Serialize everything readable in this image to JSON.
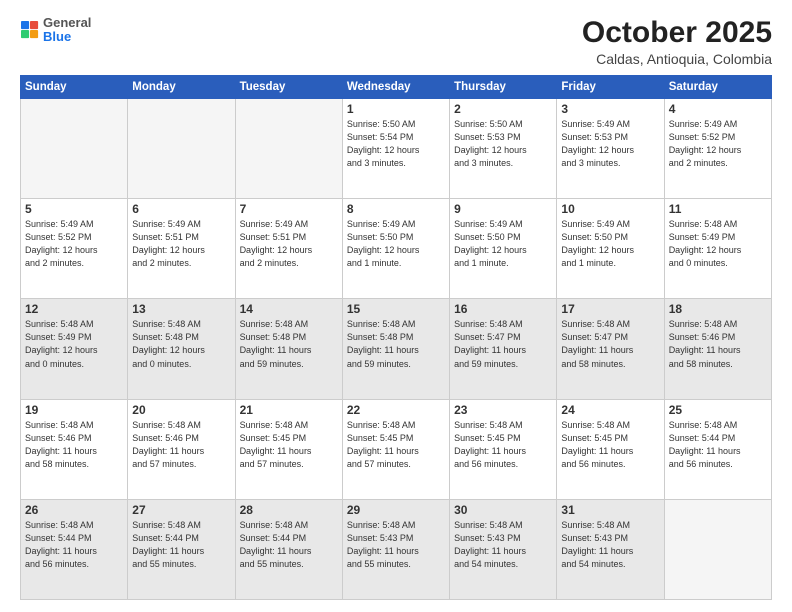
{
  "logo": {
    "general": "General",
    "blue": "Blue"
  },
  "title": "October 2025",
  "subtitle": "Caldas, Antioquia, Colombia",
  "headers": [
    "Sunday",
    "Monday",
    "Tuesday",
    "Wednesday",
    "Thursday",
    "Friday",
    "Saturday"
  ],
  "weeks": [
    [
      {
        "day": "",
        "info": "",
        "empty": true
      },
      {
        "day": "",
        "info": "",
        "empty": true
      },
      {
        "day": "",
        "info": "",
        "empty": true
      },
      {
        "day": "1",
        "info": "Sunrise: 5:50 AM\nSunset: 5:54 PM\nDaylight: 12 hours\nand 3 minutes."
      },
      {
        "day": "2",
        "info": "Sunrise: 5:50 AM\nSunset: 5:53 PM\nDaylight: 12 hours\nand 3 minutes."
      },
      {
        "day": "3",
        "info": "Sunrise: 5:49 AM\nSunset: 5:53 PM\nDaylight: 12 hours\nand 3 minutes."
      },
      {
        "day": "4",
        "info": "Sunrise: 5:49 AM\nSunset: 5:52 PM\nDaylight: 12 hours\nand 2 minutes."
      }
    ],
    [
      {
        "day": "5",
        "info": "Sunrise: 5:49 AM\nSunset: 5:52 PM\nDaylight: 12 hours\nand 2 minutes."
      },
      {
        "day": "6",
        "info": "Sunrise: 5:49 AM\nSunset: 5:51 PM\nDaylight: 12 hours\nand 2 minutes."
      },
      {
        "day": "7",
        "info": "Sunrise: 5:49 AM\nSunset: 5:51 PM\nDaylight: 12 hours\nand 2 minutes."
      },
      {
        "day": "8",
        "info": "Sunrise: 5:49 AM\nSunset: 5:50 PM\nDaylight: 12 hours\nand 1 minute."
      },
      {
        "day": "9",
        "info": "Sunrise: 5:49 AM\nSunset: 5:50 PM\nDaylight: 12 hours\nand 1 minute."
      },
      {
        "day": "10",
        "info": "Sunrise: 5:49 AM\nSunset: 5:50 PM\nDaylight: 12 hours\nand 1 minute."
      },
      {
        "day": "11",
        "info": "Sunrise: 5:48 AM\nSunset: 5:49 PM\nDaylight: 12 hours\nand 0 minutes."
      }
    ],
    [
      {
        "day": "12",
        "info": "Sunrise: 5:48 AM\nSunset: 5:49 PM\nDaylight: 12 hours\nand 0 minutes.",
        "shaded": true
      },
      {
        "day": "13",
        "info": "Sunrise: 5:48 AM\nSunset: 5:48 PM\nDaylight: 12 hours\nand 0 minutes.",
        "shaded": true
      },
      {
        "day": "14",
        "info": "Sunrise: 5:48 AM\nSunset: 5:48 PM\nDaylight: 11 hours\nand 59 minutes.",
        "shaded": true
      },
      {
        "day": "15",
        "info": "Sunrise: 5:48 AM\nSunset: 5:48 PM\nDaylight: 11 hours\nand 59 minutes.",
        "shaded": true
      },
      {
        "day": "16",
        "info": "Sunrise: 5:48 AM\nSunset: 5:47 PM\nDaylight: 11 hours\nand 59 minutes.",
        "shaded": true
      },
      {
        "day": "17",
        "info": "Sunrise: 5:48 AM\nSunset: 5:47 PM\nDaylight: 11 hours\nand 58 minutes.",
        "shaded": true
      },
      {
        "day": "18",
        "info": "Sunrise: 5:48 AM\nSunset: 5:46 PM\nDaylight: 11 hours\nand 58 minutes.",
        "shaded": true
      }
    ],
    [
      {
        "day": "19",
        "info": "Sunrise: 5:48 AM\nSunset: 5:46 PM\nDaylight: 11 hours\nand 58 minutes."
      },
      {
        "day": "20",
        "info": "Sunrise: 5:48 AM\nSunset: 5:46 PM\nDaylight: 11 hours\nand 57 minutes."
      },
      {
        "day": "21",
        "info": "Sunrise: 5:48 AM\nSunset: 5:45 PM\nDaylight: 11 hours\nand 57 minutes."
      },
      {
        "day": "22",
        "info": "Sunrise: 5:48 AM\nSunset: 5:45 PM\nDaylight: 11 hours\nand 57 minutes."
      },
      {
        "day": "23",
        "info": "Sunrise: 5:48 AM\nSunset: 5:45 PM\nDaylight: 11 hours\nand 56 minutes."
      },
      {
        "day": "24",
        "info": "Sunrise: 5:48 AM\nSunset: 5:45 PM\nDaylight: 11 hours\nand 56 minutes."
      },
      {
        "day": "25",
        "info": "Sunrise: 5:48 AM\nSunset: 5:44 PM\nDaylight: 11 hours\nand 56 minutes."
      }
    ],
    [
      {
        "day": "26",
        "info": "Sunrise: 5:48 AM\nSunset: 5:44 PM\nDaylight: 11 hours\nand 56 minutes.",
        "shaded": true
      },
      {
        "day": "27",
        "info": "Sunrise: 5:48 AM\nSunset: 5:44 PM\nDaylight: 11 hours\nand 55 minutes.",
        "shaded": true
      },
      {
        "day": "28",
        "info": "Sunrise: 5:48 AM\nSunset: 5:44 PM\nDaylight: 11 hours\nand 55 minutes.",
        "shaded": true
      },
      {
        "day": "29",
        "info": "Sunrise: 5:48 AM\nSunset: 5:43 PM\nDaylight: 11 hours\nand 55 minutes.",
        "shaded": true
      },
      {
        "day": "30",
        "info": "Sunrise: 5:48 AM\nSunset: 5:43 PM\nDaylight: 11 hours\nand 54 minutes.",
        "shaded": true
      },
      {
        "day": "31",
        "info": "Sunrise: 5:48 AM\nSunset: 5:43 PM\nDaylight: 11 hours\nand 54 minutes.",
        "shaded": true
      },
      {
        "day": "",
        "info": "",
        "empty": true,
        "shaded": true
      }
    ]
  ]
}
